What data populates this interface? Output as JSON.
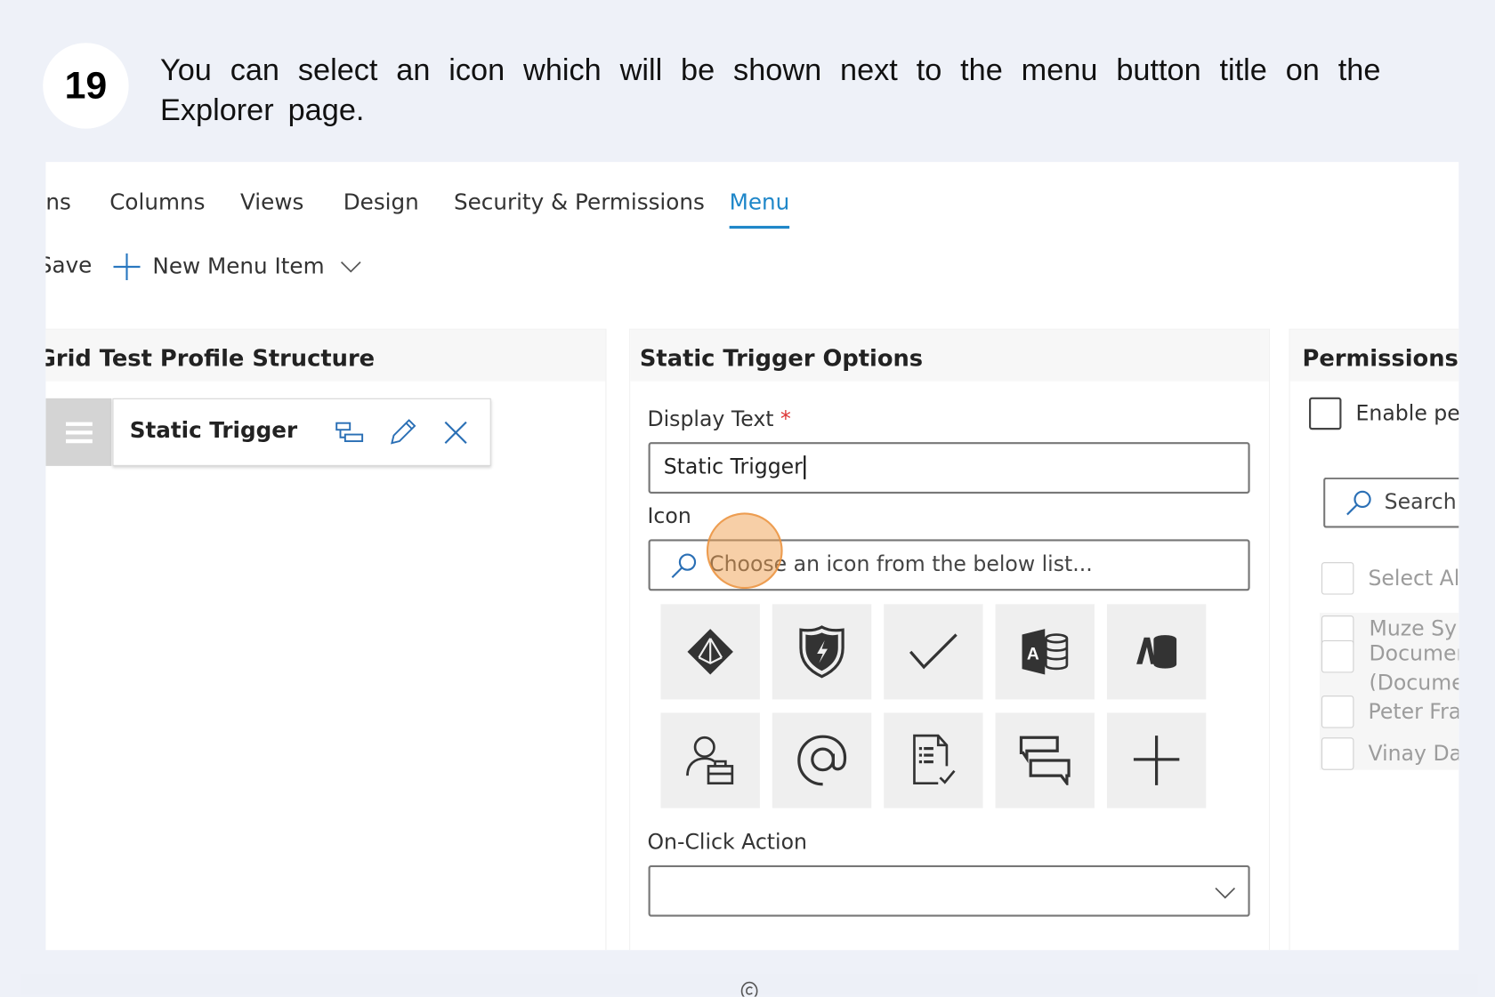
{
  "step": {
    "number": "19",
    "text": "You can select an icon which will be shown next to the menu button title on the Explorer page."
  },
  "tabs": [
    {
      "label": "ns"
    },
    {
      "label": "Columns"
    },
    {
      "label": "Views"
    },
    {
      "label": "Design"
    },
    {
      "label": "Security & Permissions"
    },
    {
      "label": "Menu",
      "active": true
    }
  ],
  "toolbar": {
    "save_label": "Save",
    "new_item_label": "New Menu Item"
  },
  "structure": {
    "title": "Grid Test Profile Structure",
    "item": {
      "label": "Static Trigger",
      "icons": [
        "hierarchy-icon",
        "pencil-icon",
        "close-icon"
      ]
    }
  },
  "options": {
    "title": "Static Trigger Options",
    "display_text_label": "Display Text",
    "required_marker": "*",
    "display_text_value": "Static Trigger",
    "icon_label": "Icon",
    "icon_placeholder": "Choose an icon from the below list...",
    "icons": [
      "azure-ad-icon",
      "shield-lightning-icon",
      "checkmark-icon",
      "access-database-icon",
      "access-logo-icon",
      "user-briefcase-icon",
      "at-sign-icon",
      "document-checklist-icon",
      "chat-bubbles-icon",
      "plus-icon"
    ],
    "on_click_label": "On-Click Action",
    "on_click_value": ""
  },
  "permissions": {
    "title": "Permissions",
    "enable_label": "Enable pe",
    "search_placeholder": "Search",
    "items": [
      "Select Al",
      "Muze Sy",
      "Documer",
      "(Docume",
      "Peter Fra",
      "Vinay Da"
    ]
  },
  "colors": {
    "accent": "#1f87c9",
    "background": "#eef1f8",
    "highlight": "#f0a050"
  }
}
